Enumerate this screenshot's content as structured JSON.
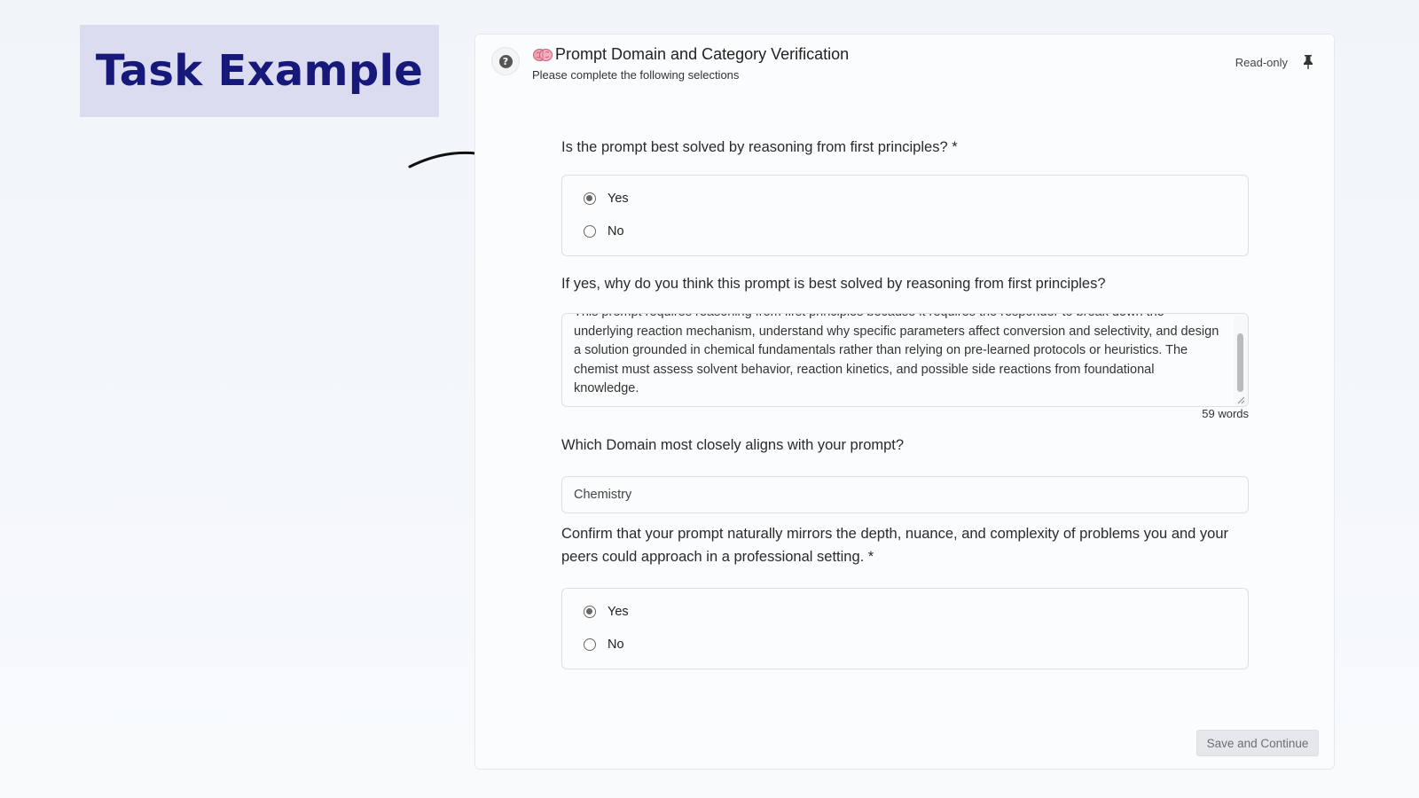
{
  "banner": {
    "title": "Task Example"
  },
  "header": {
    "title": "Prompt Domain and Category Verification",
    "subtitle": "Please complete the following selections",
    "readonly_label": "Read-only",
    "help_icon_glyph": "?"
  },
  "questions": {
    "first_principles": {
      "label": "Is the prompt best solved by reasoning from first principles? *",
      "options": [
        "Yes",
        "No"
      ],
      "selected": "Yes"
    },
    "first_principles_reason": {
      "label": "If yes, why do you think this prompt is best solved by reasoning from first principles?",
      "value": "This prompt requires reasoning from first principles because it requires the responder to break down the underlying reaction mechanism, understand why specific parameters affect conversion and selectivity, and design a solution grounded in chemical fundamentals rather than relying on pre-learned protocols or heuristics. The chemist must assess solvent behavior, reaction kinetics, and possible side reactions from foundational knowledge.",
      "word_count": "59 words"
    },
    "domain": {
      "label": "Which Domain most closely aligns with your prompt?",
      "value": "Chemistry"
    },
    "complexity": {
      "label": "Confirm that your prompt naturally mirrors the depth, nuance, and complexity of problems you and your peers could approach in a professional setting. *",
      "options": [
        "Yes",
        "No"
      ],
      "selected": "Yes"
    }
  },
  "footer": {
    "save_label": "Save and Continue"
  },
  "colors": {
    "banner_bg": "#dcdcf0",
    "banner_text": "#16197a",
    "panel_bg": "#fafcfe",
    "button_bg": "#e5e7ea"
  }
}
